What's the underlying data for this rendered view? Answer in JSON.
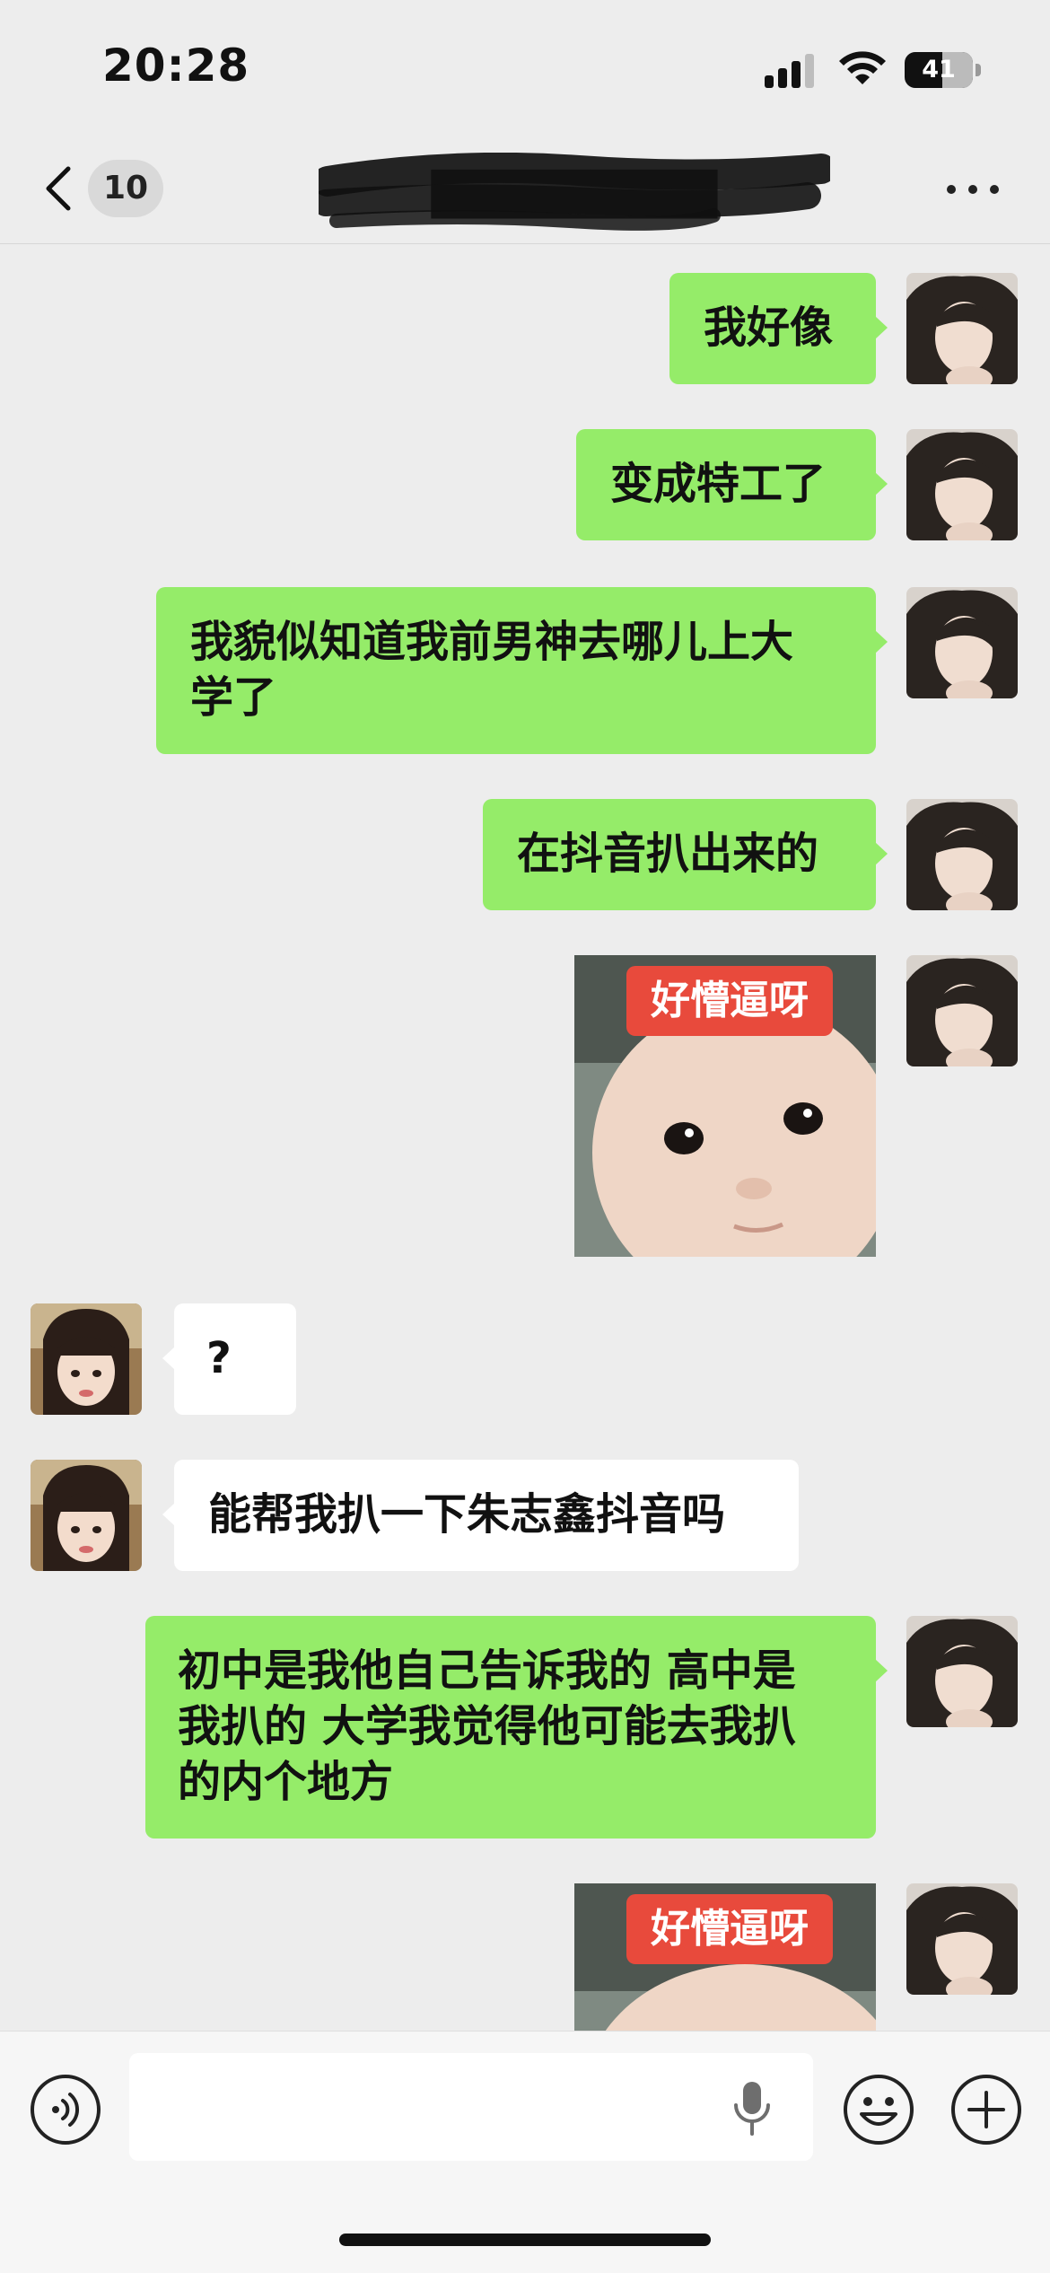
{
  "status_bar": {
    "time": "20:28",
    "battery": "41"
  },
  "header": {
    "unread_count": "10",
    "title": "█████████"
  },
  "messages": [
    {
      "side": "out",
      "type": "text",
      "lines": [
        "我好像"
      ]
    },
    {
      "side": "out",
      "type": "text",
      "lines": [
        "变成特工了"
      ]
    },
    {
      "side": "out",
      "type": "text",
      "lines": [
        "我貌似知道我前男神去哪儿上大",
        "学了"
      ]
    },
    {
      "side": "out",
      "type": "text",
      "lines": [
        "在抖音扒出来的"
      ]
    },
    {
      "side": "out",
      "type": "sticker",
      "label": "好懵逼呀"
    },
    {
      "side": "in",
      "type": "text",
      "lines": [
        "?"
      ]
    },
    {
      "side": "in",
      "type": "text",
      "lines": [
        "能帮我扒一下朱志鑫抖音吗"
      ]
    },
    {
      "side": "out",
      "type": "text",
      "lines": [
        "初中是我他自己告诉我的 高中是",
        "我扒的 大学我觉得他可能去我扒",
        "的内个地方"
      ]
    },
    {
      "side": "out",
      "type": "sticker",
      "label": "好懵逼呀"
    }
  ],
  "input_bar": {
    "placeholder": ""
  },
  "icons": {
    "back": "chevron-left-icon",
    "more": "more-dots-icon",
    "voice": "voice-icon",
    "mic": "microphone-icon",
    "emoji": "emoji-icon",
    "plus": "plus-icon"
  },
  "colors": {
    "outgoing_bubble": "#95ec69",
    "incoming_bubble": "#ffffff",
    "background": "#ededed",
    "sticker_label": "#e84a3c"
  }
}
